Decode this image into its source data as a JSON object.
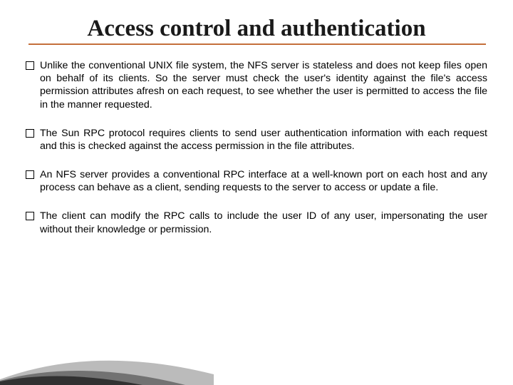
{
  "title": "Access control and authentication",
  "bullets": [
    "Unlike the conventional UNIX file system, the NFS server is stateless and does not keep files open on behalf of its clients. So the server must check the user's identity against the file's access permission attributes afresh on each request, to see whether the user is permitted to access the file in the manner requested.",
    "The Sun RPC protocol requires clients to send user authentication information with each request and this is checked against the access permission in the file attributes.",
    "An NFS server provides a conventional RPC interface at a well-known port on each host and any process can behave as a client, sending requests to the server to access or update a file.",
    "The client can modify the RPC calls to include the user ID of any user, impersonating the user without their knowledge or permission."
  ]
}
